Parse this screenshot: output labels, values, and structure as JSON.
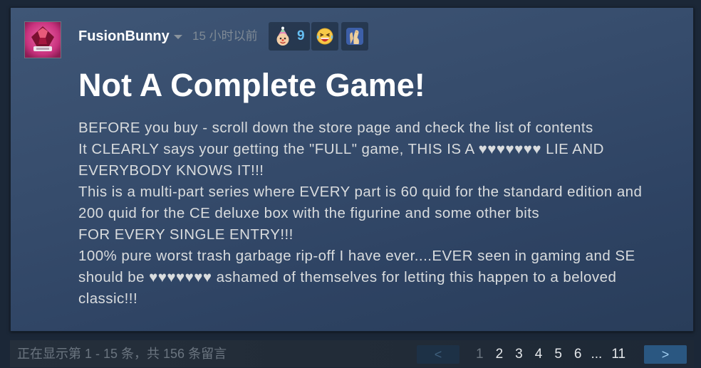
{
  "review": {
    "author": {
      "name": "FusionBunny"
    },
    "timestamp": "15 小时以前",
    "awards": [
      {
        "icon": "clown-face-icon",
        "count": "9"
      },
      {
        "icon": "laughing-face-icon"
      },
      {
        "icon": "clapping-hands-icon"
      }
    ],
    "title": "Not A Complete Game!",
    "body_lines": [
      "BEFORE you buy - scroll down the store page and check the list of contents",
      "It CLEARLY says your getting the \"FULL\" game, THIS IS A ♥♥♥♥♥♥♥ LIE AND",
      "EVERYBODY KNOWS IT!!!",
      "This is a multi-part series where EVERY part is 60 quid for the standard edition and",
      "200 quid for the CE deluxe box with the figurine and some other bits",
      "FOR EVERY SINGLE ENTRY!!!",
      "100% pure worst trash garbage rip-off I have ever....EVER seen in gaming and SE",
      "should be ♥♥♥♥♥♥♥ ashamed of themselves for letting this happen to a beloved",
      "classic!!!"
    ]
  },
  "pagination": {
    "summary": "正在显示第 1 - 15 条，共 156 条留言",
    "prev_label": "<",
    "next_label": ">",
    "pages": [
      {
        "label": "1",
        "current": true
      },
      {
        "label": "2",
        "current": false
      },
      {
        "label": "3",
        "current": false
      },
      {
        "label": "4",
        "current": false
      },
      {
        "label": "5",
        "current": false
      },
      {
        "label": "6",
        "current": false
      }
    ],
    "ellipsis": "...",
    "last_page": "11"
  },
  "colors": {
    "accent_blue": "#66c0f4",
    "body_text": "#d9dcde",
    "muted_text": "#7f8a95"
  }
}
